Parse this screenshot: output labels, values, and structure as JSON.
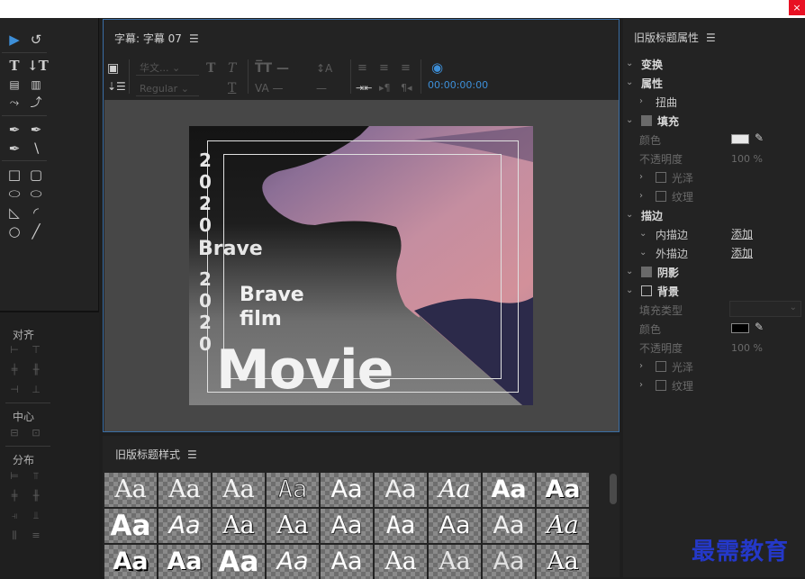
{
  "window": {
    "close_glyph": "×"
  },
  "tools_panel": {
    "align_label": "对齐",
    "center_label": "中心",
    "distribute_label": "分布"
  },
  "title_panel": {
    "tab_label": "字幕: 字幕 07",
    "font_family": "华文...",
    "font_style": "Regular",
    "timecode": "00:00:00:00"
  },
  "canvas": {
    "vertical_year_top": [
      "2",
      "0",
      "2",
      "0"
    ],
    "vertical_year_bottom": [
      "2",
      "0",
      "2",
      "0"
    ],
    "brave_text": "Brave",
    "brave_film": [
      "Brave",
      "film"
    ],
    "movie_text": "Movie"
  },
  "styles_panel": {
    "tab_label": "旧版标题样式",
    "swatch_label": "Aa"
  },
  "props_panel": {
    "tab_label": "旧版标题属性",
    "transform": "变换",
    "properties": "属性",
    "distort": "扭曲",
    "fill": "填充",
    "color": "颜色",
    "opacity": "不透明度",
    "opacity_value": "100 %",
    "sheen": "光泽",
    "texture": "纹理",
    "strokes": "描边",
    "inner_stroke": "内描边",
    "outer_stroke": "外描边",
    "add": "添加",
    "shadow": "阴影",
    "background": "背景",
    "fill_type": "填充类型",
    "fill_color_hex": "#e8e8e8",
    "bg_color_hex": "#000000"
  },
  "watermark": "最需教育"
}
